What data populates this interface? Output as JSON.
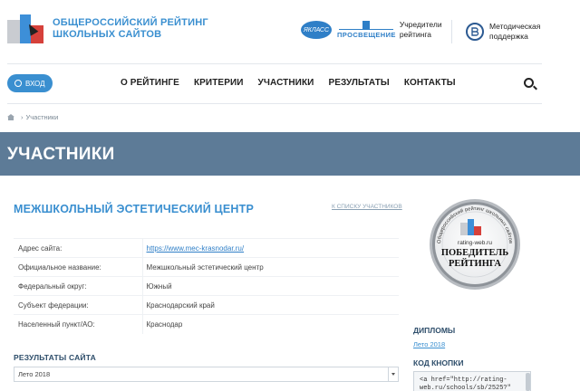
{
  "header": {
    "logo_line1": "ОБЩЕРОССИЙСКИЙ РЕЙТИНГ",
    "logo_line2": "ШКОЛЬНЫХ САЙТОВ",
    "founder_badge": "ЯКЛАСС",
    "founder_brand": "ПРОСВЕЩЕНИЕ",
    "founders_label_1": "Учредители",
    "founders_label_2": "рейтинга",
    "method_badge": "ВШЭ",
    "method_label_1": "Методическая",
    "method_label_2": "поддержка"
  },
  "nav": {
    "login": "ВХОД",
    "items": [
      "О РЕЙТИНГЕ",
      "КРИТЕРИИ",
      "УЧАСТНИКИ",
      "РЕЗУЛЬТАТЫ",
      "КОНТАКТЫ"
    ]
  },
  "breadcrumb": {
    "current": "Участники"
  },
  "banner": {
    "title": "УЧАСТНИКИ"
  },
  "main": {
    "org_title": "МЕЖШКОЛЬНЫЙ ЭСТЕТИЧЕСКИЙ ЦЕНТР",
    "back_link": "К СПИСКУ УЧАСТНИКОВ",
    "rows": [
      {
        "key": "Адрес сайта:",
        "value": "https://www.mec-krasnodar.ru/"
      },
      {
        "key": "Официальное название:",
        "value": "Межшкольный эстетический центр"
      },
      {
        "key": "Федеральный округ:",
        "value": "Южный"
      },
      {
        "key": "Субъект федерации:",
        "value": "Краснодарский край"
      },
      {
        "key": "Населенный пункт/АО:",
        "value": "Краснодар"
      }
    ],
    "results_title": "РЕЗУЛЬТАТЫ САЙТА",
    "results_select": "Лето 2018"
  },
  "aside": {
    "seal_arc_text": "Общероссийский рейтинг школьных сайтов",
    "seal_url": "rating-web.ru",
    "seal_line1": "ПОБЕДИТЕЛЬ",
    "seal_line2": "РЕЙТИНГА",
    "diplomas_title": "ДИПЛОМЫ",
    "diploma_link": "Лето 2018",
    "code_title": "КОД КНОПКИ",
    "code_text": "<a href=\"http://rating-web.ru/schools/sb/2525?\""
  },
  "colors": {
    "accent": "#3a8fd0",
    "banner": "#5d7b97",
    "heading_dark": "#2d4d6a"
  }
}
